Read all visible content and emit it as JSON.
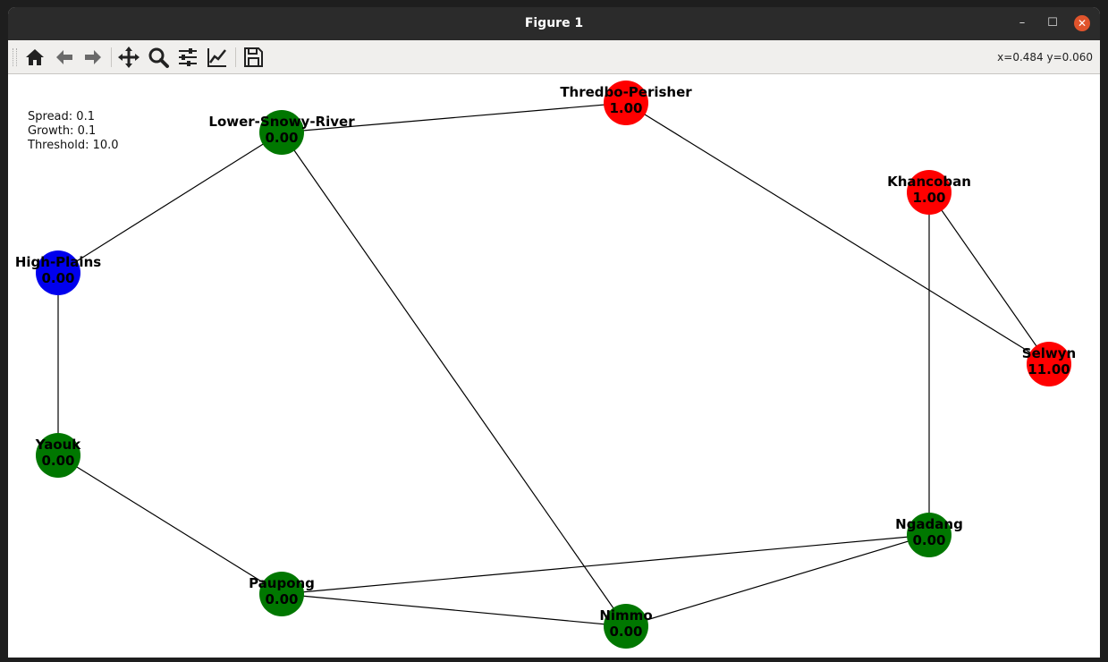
{
  "window": {
    "title": "Figure 1",
    "min_glyph": "–",
    "max_glyph": "☐",
    "close_glyph": "✕"
  },
  "toolbar": {
    "buttons": [
      "home-icon",
      "back-icon",
      "forward-icon",
      "pan-icon",
      "zoom-icon",
      "configure-subplots-icon",
      "edit-axis-icon",
      "save-icon"
    ],
    "coords": "x=0.484 y=0.060"
  },
  "params": {
    "spread": "Spread: 0.1",
    "growth": "Growth: 0.1",
    "threshold": "Threshold: 10.0"
  },
  "colors": {
    "green": "#007700",
    "red": "#ff0000",
    "blue": "#0000ee"
  },
  "graph": {
    "nodes": [
      {
        "id": "thredbo",
        "name": "Thredbo-Perisher",
        "value": "1.00",
        "color": "red"
      },
      {
        "id": "lower",
        "name": "Lower-Snowy-River",
        "value": "0.00",
        "color": "green"
      },
      {
        "id": "khancoban",
        "name": "Khancoban",
        "value": "1.00",
        "color": "red"
      },
      {
        "id": "highplains",
        "name": "High-Plains",
        "value": "0.00",
        "color": "blue"
      },
      {
        "id": "selwyn",
        "name": "Selwyn",
        "value": "11.00",
        "color": "red"
      },
      {
        "id": "yaouk",
        "name": "Yaouk",
        "value": "0.00",
        "color": "green"
      },
      {
        "id": "ngadang",
        "name": "Ngadang",
        "value": "0.00",
        "color": "green"
      },
      {
        "id": "paupong",
        "name": "Paupong",
        "value": "0.00",
        "color": "green"
      },
      {
        "id": "nimmo",
        "name": "Nimmo",
        "value": "0.00",
        "color": "green"
      }
    ],
    "edges": [
      [
        "lower",
        "thredbo"
      ],
      [
        "lower",
        "highplains"
      ],
      [
        "lower",
        "nimmo"
      ],
      [
        "thredbo",
        "selwyn"
      ],
      [
        "khancoban",
        "selwyn"
      ],
      [
        "khancoban",
        "ngadang"
      ],
      [
        "highplains",
        "yaouk"
      ],
      [
        "yaouk",
        "paupong"
      ],
      [
        "paupong",
        "ngadang"
      ],
      [
        "paupong",
        "nimmo"
      ],
      [
        "nimmo",
        "ngadang"
      ]
    ]
  }
}
